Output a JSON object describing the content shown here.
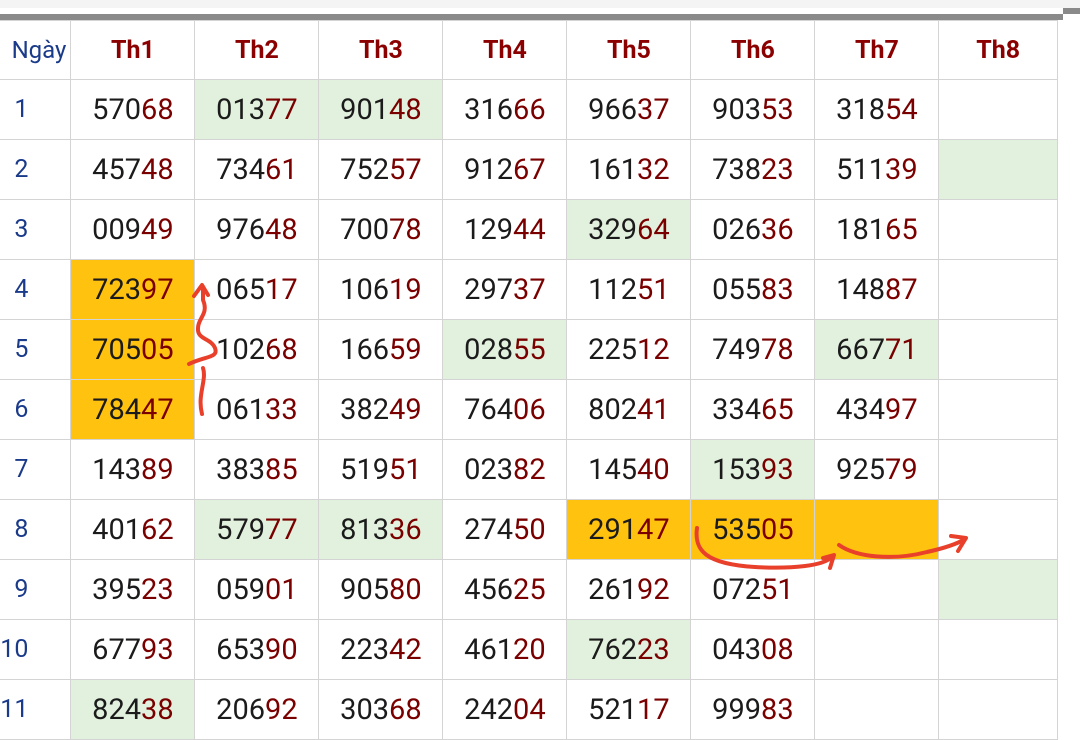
{
  "header": {
    "day_label": "Ngày",
    "columns": [
      "Th1",
      "Th2",
      "Th3",
      "Th4",
      "Th5",
      "Th6",
      "Th7",
      "Th8"
    ]
  },
  "rows": [
    {
      "day": "1",
      "cells": [
        [
          "570",
          "68"
        ],
        [
          "013",
          "77"
        ],
        [
          "901",
          "48"
        ],
        [
          "316",
          "66"
        ],
        [
          "966",
          "37"
        ],
        [
          "903",
          "53"
        ],
        [
          "318",
          "54"
        ],
        [
          "",
          ""
        ]
      ]
    },
    {
      "day": "2",
      "cells": [
        [
          "457",
          "48"
        ],
        [
          "734",
          "61"
        ],
        [
          "752",
          "57"
        ],
        [
          "912",
          "67"
        ],
        [
          "161",
          "32"
        ],
        [
          "738",
          "23"
        ],
        [
          "511",
          "39"
        ],
        [
          "",
          ""
        ]
      ]
    },
    {
      "day": "3",
      "cells": [
        [
          "009",
          "49"
        ],
        [
          "976",
          "48"
        ],
        [
          "700",
          "78"
        ],
        [
          "129",
          "44"
        ],
        [
          "329",
          "64"
        ],
        [
          "026",
          "36"
        ],
        [
          "181",
          "65"
        ],
        [
          "",
          ""
        ]
      ]
    },
    {
      "day": "4",
      "cells": [
        [
          "723",
          "97"
        ],
        [
          "065",
          "17"
        ],
        [
          "106",
          "19"
        ],
        [
          "297",
          "37"
        ],
        [
          "112",
          "51"
        ],
        [
          "055",
          "83"
        ],
        [
          "148",
          "87"
        ],
        [
          "",
          ""
        ]
      ]
    },
    {
      "day": "5",
      "cells": [
        [
          "705",
          "05"
        ],
        [
          "102",
          "68"
        ],
        [
          "166",
          "59"
        ],
        [
          "028",
          "55"
        ],
        [
          "225",
          "12"
        ],
        [
          "749",
          "78"
        ],
        [
          "667",
          "71"
        ],
        [
          "",
          ""
        ]
      ]
    },
    {
      "day": "6",
      "cells": [
        [
          "784",
          "47"
        ],
        [
          "061",
          "33"
        ],
        [
          "382",
          "49"
        ],
        [
          "764",
          "06"
        ],
        [
          "802",
          "41"
        ],
        [
          "334",
          "65"
        ],
        [
          "434",
          "97"
        ],
        [
          "",
          ""
        ]
      ]
    },
    {
      "day": "7",
      "cells": [
        [
          "143",
          "89"
        ],
        [
          "383",
          "85"
        ],
        [
          "519",
          "51"
        ],
        [
          "023",
          "82"
        ],
        [
          "145",
          "40"
        ],
        [
          "153",
          "93"
        ],
        [
          "925",
          "79"
        ],
        [
          "",
          ""
        ]
      ]
    },
    {
      "day": "8",
      "cells": [
        [
          "401",
          "62"
        ],
        [
          "579",
          "77"
        ],
        [
          "813",
          "36"
        ],
        [
          "274",
          "50"
        ],
        [
          "291",
          "47"
        ],
        [
          "535",
          "05"
        ],
        [
          "",
          ""
        ],
        [
          "",
          ""
        ]
      ]
    },
    {
      "day": "9",
      "cells": [
        [
          "395",
          "23"
        ],
        [
          "059",
          "01"
        ],
        [
          "905",
          "80"
        ],
        [
          "456",
          "25"
        ],
        [
          "261",
          "92"
        ],
        [
          "072",
          "51"
        ],
        [
          "",
          ""
        ],
        [
          "",
          ""
        ]
      ]
    },
    {
      "day": "10",
      "cells": [
        [
          "677",
          "93"
        ],
        [
          "653",
          "90"
        ],
        [
          "223",
          "42"
        ],
        [
          "461",
          "20"
        ],
        [
          "762",
          "23"
        ],
        [
          "043",
          "08"
        ],
        [
          "",
          ""
        ],
        [
          "",
          ""
        ]
      ]
    },
    {
      "day": "11",
      "cells": [
        [
          "824",
          "38"
        ],
        [
          "206",
          "92"
        ],
        [
          "303",
          "68"
        ],
        [
          "242",
          "04"
        ],
        [
          "521",
          "17"
        ],
        [
          "999",
          "83"
        ],
        [
          "",
          ""
        ],
        [
          "",
          ""
        ]
      ]
    }
  ],
  "colors": {
    "highlight_green": "#e2f1dd",
    "highlight_orange": "#ffc20e",
    "number_dark": "#1b1b1b",
    "number_tail": "#7a0000",
    "header_text": "#8b0000",
    "day_text": "#1a3a8a",
    "annotation_red": "#e8402a"
  }
}
